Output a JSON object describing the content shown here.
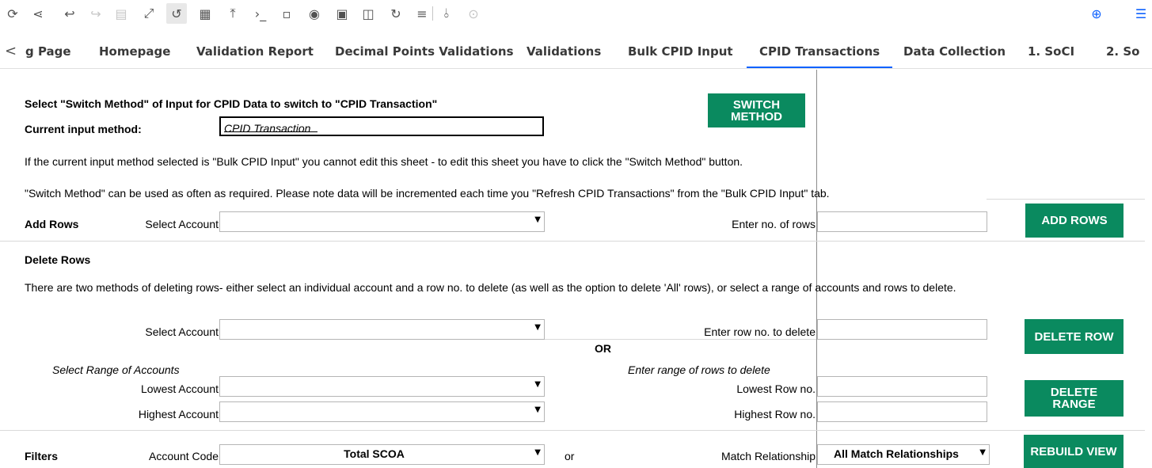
{
  "toolbar": {
    "icons": [
      "refresh-icon",
      "share-icon",
      "undo-icon",
      "redo-icon",
      "format-icon",
      "expand-icon",
      "reset-icon",
      "qr-icon",
      "upload-icon",
      "terminal-icon",
      "save-icon",
      "run-icon",
      "image-icon",
      "note-icon",
      "sync-icon",
      "align-icon",
      "thermometer-icon",
      "check-circle-icon",
      "zoom-in-icon",
      "menu-icon"
    ]
  },
  "tabs": {
    "prev": "<",
    "items": [
      {
        "label": "g Page"
      },
      {
        "label": "Homepage"
      },
      {
        "label": "Validation Report"
      },
      {
        "label": "Decimal Points Validations"
      },
      {
        "label": "Validations"
      },
      {
        "label": "Bulk CPID Input"
      },
      {
        "label": "CPID Transactions",
        "active": true
      },
      {
        "label": "Data Collection"
      },
      {
        "label": "1. SoCI"
      },
      {
        "label": "2. So"
      }
    ]
  },
  "sheet": {
    "switch_heading": "Select \"Switch Method\" of Input for CPID Data to switch to \"CPID Transaction\"",
    "current_method_label": "Current input method:",
    "current_method_value": "CPID Transaction",
    "switch_button": "SWITCH METHOD",
    "info_line_1": "If the current input method selected is \"Bulk CPID Input\" you cannot edit this sheet - to edit this sheet you have to click the \"Switch Method\" button.",
    "info_line_2": "\"Switch Method\" can be used as often as required. Please note data will be incremented each time you \"Refresh CPID Transactions\" from the \"Bulk CPID Input\" tab.",
    "add_rows": {
      "heading": "Add Rows",
      "select_account_label": "Select Account",
      "select_account_value": "",
      "rows_label": "Enter no. of rows",
      "rows_value": "",
      "button": "ADD ROWS"
    },
    "delete_rows": {
      "heading": "Delete Rows",
      "description": "There are two methods of deleting rows- either select an individual account and a row no. to delete (as well as the option to delete 'All' rows), or select a range of accounts and rows to delete.",
      "select_account_label": "Select Account",
      "row_label": "Enter row no. to delete",
      "delete_row_button": "DELETE ROW",
      "or_label": "OR",
      "range_accounts_label": "Select Range of Accounts",
      "range_rows_label": "Enter range of rows to delete",
      "lowest_account_label": "Lowest Account",
      "highest_account_label": "Highest Account",
      "lowest_row_label": "Lowest Row no.",
      "highest_row_label": "Highest Row no.",
      "delete_range_button": "DELETE RANGE"
    },
    "filters": {
      "heading": "Filters",
      "account_code_label": "Account Code",
      "account_code_value": "Total SCOA",
      "or_label": "or",
      "match_label": "Match Relationship",
      "match_value": "All Match Relationships",
      "button": "REBUILD VIEW"
    }
  },
  "colors": {
    "accent": "#0f62fe",
    "button_green": "#0a8a5f"
  }
}
